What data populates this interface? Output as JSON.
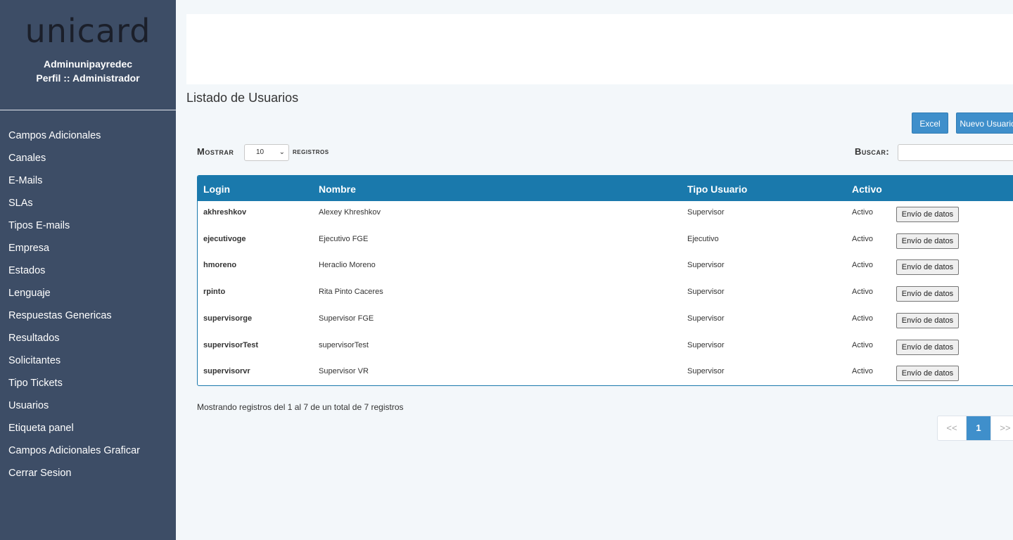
{
  "sidebar": {
    "logo": "unicard",
    "user_name": "Adminunipayredec",
    "user_profile": "Perfil :: Administrador",
    "items": [
      {
        "label": "Campos Adicionales"
      },
      {
        "label": "Canales"
      },
      {
        "label": "E-Mails"
      },
      {
        "label": "SLAs"
      },
      {
        "label": "Tipos E-mails"
      },
      {
        "label": "Empresa"
      },
      {
        "label": "Estados"
      },
      {
        "label": "Lenguaje"
      },
      {
        "label": "Respuestas Genericas"
      },
      {
        "label": "Resultados"
      },
      {
        "label": "Solicitantes"
      },
      {
        "label": "Tipo Tickets"
      },
      {
        "label": "Usuarios"
      },
      {
        "label": "Etiqueta panel"
      },
      {
        "label": "Campos Adicionales Graficar"
      },
      {
        "label": "Cerrar Sesion"
      }
    ]
  },
  "main": {
    "title": "Listado de Usuarios",
    "excel_label": "Excel",
    "new_user_label": "Nuevo Usuario",
    "length_prefix": "Mostrar",
    "length_value": "10",
    "length_suffix": "registros",
    "search_label": "Buscar:",
    "search_value": "",
    "table": {
      "headers": {
        "login": "Login",
        "nombre": "Nombre",
        "tipo": "Tipo Usuario",
        "activo": "Activo"
      },
      "rows": [
        {
          "login": "akhreshkov",
          "nombre": "Alexey Khreshkov",
          "tipo": "Supervisor",
          "activo": "Activo",
          "action": "Envío de datos"
        },
        {
          "login": "ejecutivoge",
          "nombre": "Ejecutivo FGE",
          "tipo": "Ejecutivo",
          "activo": "Activo",
          "action": "Envío de datos"
        },
        {
          "login": "hmoreno",
          "nombre": "Heraclio Moreno",
          "tipo": "Supervisor",
          "activo": "Activo",
          "action": "Envío de datos"
        },
        {
          "login": "rpinto",
          "nombre": "Rita Pinto Caceres",
          "tipo": "Supervisor",
          "activo": "Activo",
          "action": "Envío de datos"
        },
        {
          "login": "supervisorge",
          "nombre": "Supervisor FGE",
          "tipo": "Supervisor",
          "activo": "Activo",
          "action": "Envío de datos"
        },
        {
          "login": "supervisorTest",
          "nombre": "supervisorTest",
          "tipo": "Supervisor",
          "activo": "Activo",
          "action": "Envío de datos"
        },
        {
          "login": "supervisorvr",
          "nombre": "Supervisor VR",
          "tipo": "Supervisor",
          "activo": "Activo",
          "action": "Envío de datos"
        }
      ]
    },
    "info": "Mostrando registros del 1 al 7 de un total de 7 registros",
    "pagination": {
      "prev": "<<",
      "current": "1",
      "next": ">>"
    }
  },
  "colors": {
    "sidebar": "#3d4d66",
    "accent": "#3f8fcb",
    "table_header": "#1a79ac"
  }
}
